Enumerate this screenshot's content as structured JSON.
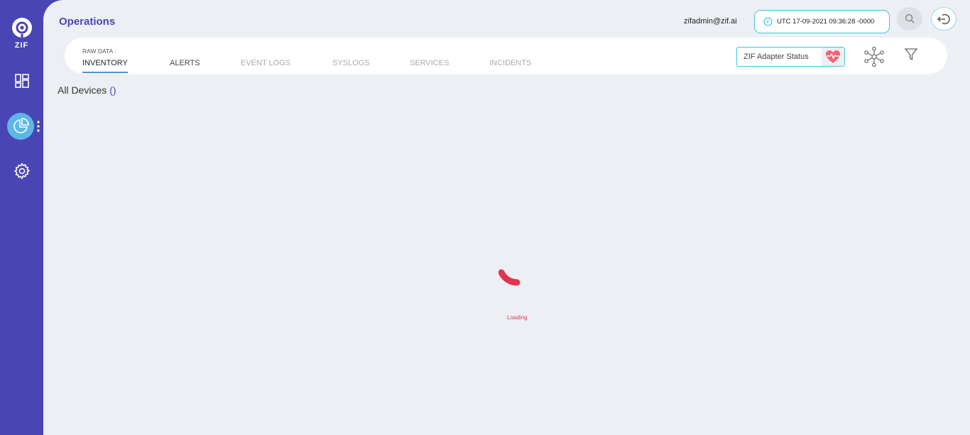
{
  "app": {
    "logo_text": "ZIF"
  },
  "sidebar": {
    "items": [
      {
        "name": "dashboard",
        "icon": "dashboard-icon"
      },
      {
        "name": "operations",
        "icon": "pie-chart-icon",
        "active": true
      },
      {
        "name": "settings",
        "icon": "gear-icon"
      }
    ]
  },
  "header": {
    "title": "Operations",
    "user_email": "zifadmin@zif.ai",
    "clock": "UTC 17-09-2021 09:36:28 -0000"
  },
  "tabbar": {
    "raw_label": "RAW DATA :",
    "tabs": [
      {
        "label": "INVENTORY",
        "active": true
      },
      {
        "label": "ALERTS"
      },
      {
        "label": "EVENT LOGS"
      },
      {
        "label": "SYSLOGS"
      },
      {
        "label": "SERVICES"
      },
      {
        "label": "INCIDENTS"
      }
    ],
    "adapter_status_label": "ZIF Adapter Status"
  },
  "content": {
    "section_title": "All Devices",
    "section_count": "()",
    "loading_text": "Loading"
  },
  "colors": {
    "sidebar": "#4a45b5",
    "accent": "#4a45b5",
    "active_nav": "#5bb7e8",
    "loader": "#e0354f",
    "border_accent": "#3fc7d5"
  }
}
